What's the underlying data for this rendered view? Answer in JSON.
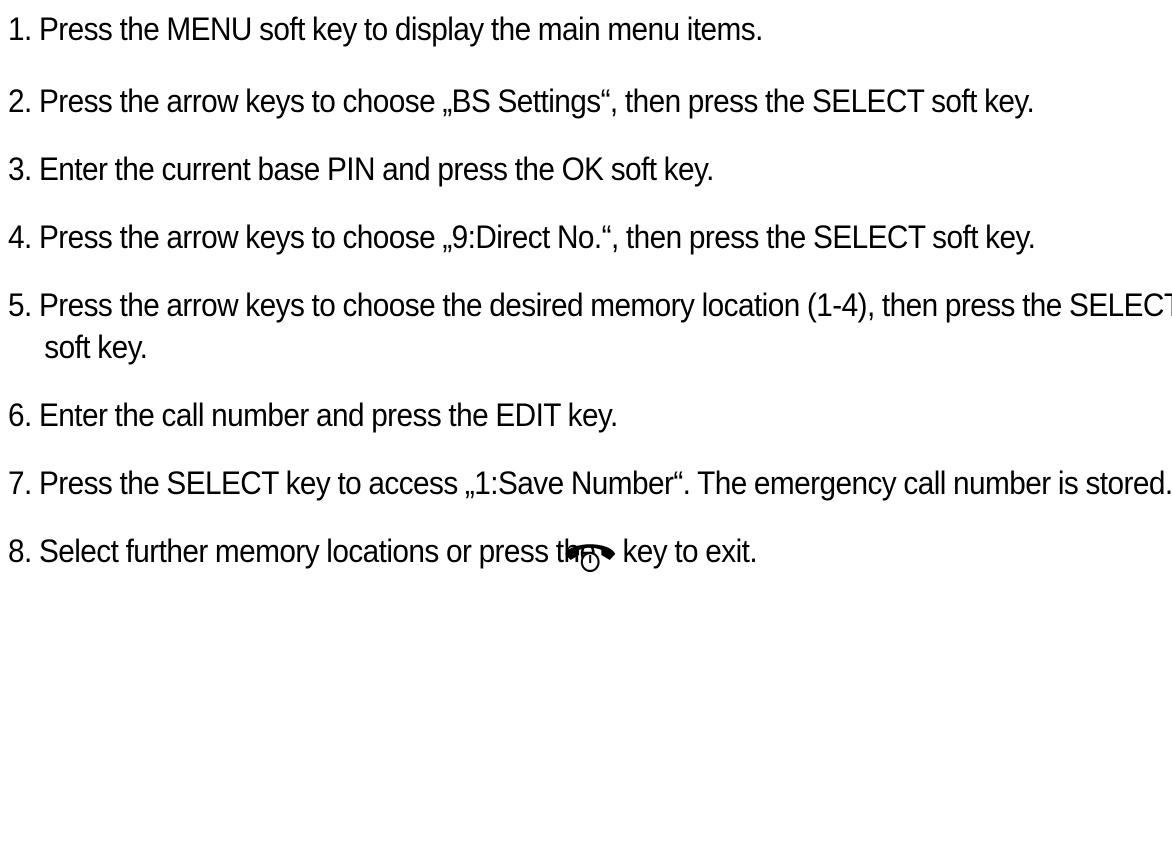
{
  "steps": [
    {
      "number": "1.",
      "text": "Press the MENU soft key to display the main menu items."
    },
    {
      "number": "2.",
      "text": "Press the arrow keys to choose „BS Settings“, then press the SELECT soft key."
    },
    {
      "number": "3.",
      "text": "Enter the current base PIN and press the OK soft key."
    },
    {
      "number": "4.",
      "text": "Press the arrow keys to choose „9:Direct No.“, then press the SELECT soft key."
    },
    {
      "number": "5.",
      "text": "Press the arrow keys to choose the desired memory location (1-4), then press the SELECT soft key."
    },
    {
      "number": "6.",
      "text": "Enter the call number and press the EDIT key."
    },
    {
      "number": "7.",
      "text": "Press the SELECT key to access „1:Save Number“. The emergency call number is stored."
    },
    {
      "number": "8.",
      "text_before": "Select further memory locations or press the",
      "icon": "end-call-icon",
      "text_after": "key to exit."
    }
  ]
}
